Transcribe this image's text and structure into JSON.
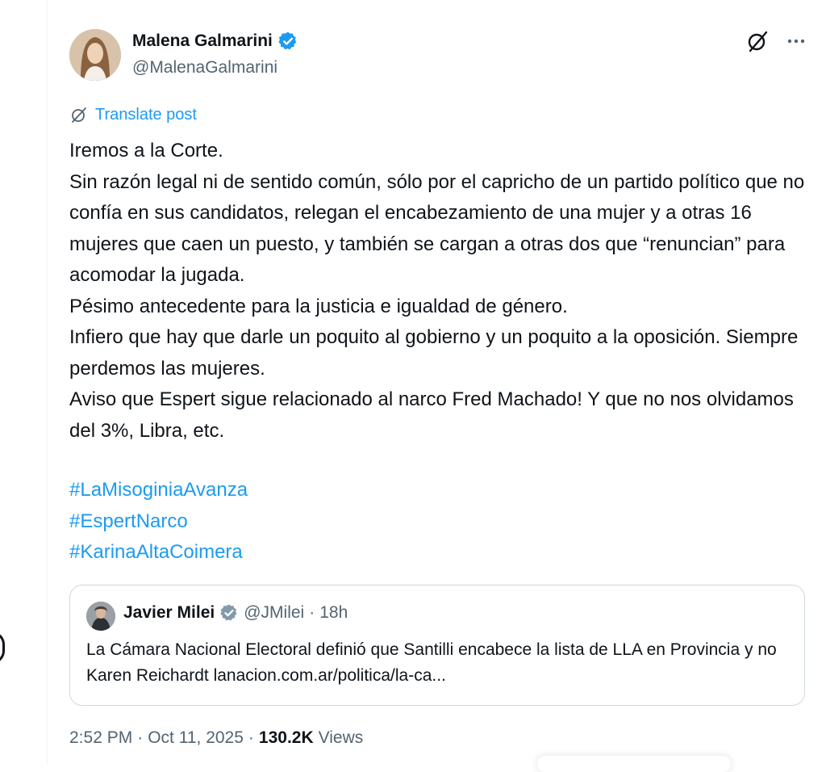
{
  "author": {
    "display_name": "Malena Galmarini",
    "handle": "@MalenaGalmarini",
    "verified": true,
    "avatar_icon": "profile-photo"
  },
  "actions": {
    "grok_icon": "grok-icon",
    "more_icon": "more-icon"
  },
  "translate_label": "Translate post",
  "body_lines": [
    "Iremos a la Corte.",
    "Sin razón legal ni de sentido común, sólo por el capricho de un partido político que no confía en sus candidatos, relegan el encabezamiento de una mujer y a otras 16 mujeres que caen un puesto, y también se cargan a otras dos que “renuncian” para acomodar la jugada.",
    "Pésimo antecedente para la justicia e igualdad de género.",
    "Infiero que hay que darle un poquito al gobierno y un poquito a la oposición. Siempre perdemos las mujeres.",
    "Aviso que Espert sigue relacionado al narco Fred Machado! Y que no nos olvidamos del 3%, Libra, etc."
  ],
  "hashtags": [
    "#LaMisoginiaAvanza",
    "#EspertNarco",
    "#KarinaAltaCoimera"
  ],
  "quote": {
    "display_name": "Javier Milei",
    "handle": "@JMilei",
    "separator": "·",
    "time": "18h",
    "verified": true,
    "text": "La Cámara Nacional Electoral definió que Santilli encabece la lista de LLA en Provincia y no Karen Reichardt  lanacion.com.ar/politica/la-ca..."
  },
  "meta": {
    "time": "2:52 PM",
    "sep1": "·",
    "date": "Oct 11, 2025",
    "sep2": "·",
    "views_count": "130.2K",
    "views_label": "Views"
  },
  "colors": {
    "link": "#1d9bf0",
    "text": "#0f1419",
    "secondary": "#536471",
    "border": "#cfd9de"
  }
}
